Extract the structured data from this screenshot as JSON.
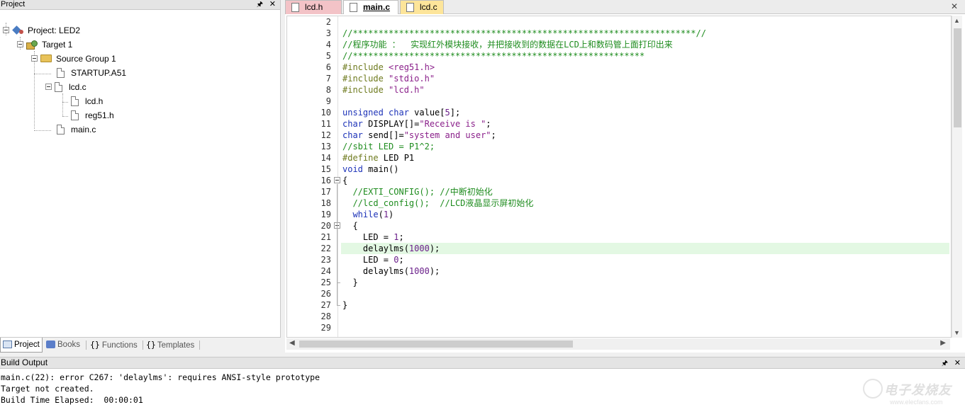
{
  "project_pane": {
    "title": "Project",
    "tree": {
      "project_label": "Project: LED2",
      "target_label": "Target 1",
      "group_label": "Source Group 1",
      "files": [
        {
          "label": "STARTUP.A51"
        },
        {
          "label": "lcd.c"
        },
        {
          "label": "lcd.h"
        },
        {
          "label": "reg51.h"
        },
        {
          "label": "main.c"
        }
      ]
    },
    "tabs": [
      {
        "label": "Project",
        "icon": "project-tab-icon"
      },
      {
        "label": "Books",
        "icon": "books-icon"
      },
      {
        "label": "Functions",
        "icon": "functions-icon"
      },
      {
        "label": "Templates",
        "icon": "templates-icon"
      }
    ]
  },
  "editor": {
    "tabs": [
      {
        "label": "lcd.h",
        "color": "#f3c3c7"
      },
      {
        "label": "main.c",
        "color": "#ffffff"
      },
      {
        "label": "lcd.c",
        "color": "#fde59a"
      }
    ],
    "highlight_line": "22",
    "lines": [
      {
        "n": "2",
        "parts": []
      },
      {
        "n": "3",
        "parts": [
          {
            "t": "//*******************************************************************//",
            "c": "c-com"
          }
        ]
      },
      {
        "n": "4",
        "parts": [
          {
            "t": "//程序功能 ：  实现红外模块接收，并把接收到的数据在LCD上和数码管上面打印出来",
            "c": "c-com"
          }
        ]
      },
      {
        "n": "5",
        "parts": [
          {
            "t": "//*********************************************************",
            "c": "c-com"
          }
        ]
      },
      {
        "n": "6",
        "parts": [
          {
            "t": "#include ",
            "c": "c-pp"
          },
          {
            "t": "<reg51.h>",
            "c": "c-str"
          }
        ]
      },
      {
        "n": "7",
        "parts": [
          {
            "t": "#include ",
            "c": "c-pp"
          },
          {
            "t": "\"stdio.h\"",
            "c": "c-str"
          }
        ]
      },
      {
        "n": "8",
        "parts": [
          {
            "t": "#include ",
            "c": "c-pp"
          },
          {
            "t": "\"lcd.h\"",
            "c": "c-str"
          }
        ]
      },
      {
        "n": "9",
        "parts": []
      },
      {
        "n": "10",
        "parts": [
          {
            "t": "unsigned ",
            "c": "c-kw"
          },
          {
            "t": "char ",
            "c": "c-kw"
          },
          {
            "t": "value[",
            "c": "c-def"
          },
          {
            "t": "5",
            "c": "c-num"
          },
          {
            "t": "];",
            "c": "c-def"
          }
        ]
      },
      {
        "n": "11",
        "parts": [
          {
            "t": "char ",
            "c": "c-kw"
          },
          {
            "t": "DISPLAY[]=",
            "c": "c-def"
          },
          {
            "t": "\"Receive is \"",
            "c": "c-str"
          },
          {
            "t": ";",
            "c": "c-def"
          }
        ]
      },
      {
        "n": "12",
        "parts": [
          {
            "t": "char ",
            "c": "c-kw"
          },
          {
            "t": "send[]=",
            "c": "c-def"
          },
          {
            "t": "\"system and user\"",
            "c": "c-str"
          },
          {
            "t": ";",
            "c": "c-def"
          }
        ]
      },
      {
        "n": "13",
        "parts": [
          {
            "t": "//sbit LED = P1^2;",
            "c": "c-com"
          }
        ]
      },
      {
        "n": "14",
        "parts": [
          {
            "t": "#define ",
            "c": "c-pp"
          },
          {
            "t": "LED P1",
            "c": "c-def"
          }
        ]
      },
      {
        "n": "15",
        "parts": [
          {
            "t": "void ",
            "c": "c-kw"
          },
          {
            "t": "main()",
            "c": "c-def"
          }
        ]
      },
      {
        "n": "16",
        "parts": [
          {
            "t": "{",
            "c": "c-def"
          }
        ]
      },
      {
        "n": "17",
        "parts": [
          {
            "t": "  //EXTI_CONFIG(); //中断初始化",
            "c": "c-com"
          }
        ]
      },
      {
        "n": "18",
        "parts": [
          {
            "t": "  //lcd_config();  //LCD液晶显示屏初始化",
            "c": "c-com"
          }
        ]
      },
      {
        "n": "19",
        "parts": [
          {
            "t": "  ",
            "c": "c-def"
          },
          {
            "t": "while",
            "c": "c-kw"
          },
          {
            "t": "(",
            "c": "c-def"
          },
          {
            "t": "1",
            "c": "c-num"
          },
          {
            "t": ")",
            "c": "c-def"
          }
        ]
      },
      {
        "n": "20",
        "parts": [
          {
            "t": "  {",
            "c": "c-def"
          }
        ]
      },
      {
        "n": "21",
        "parts": [
          {
            "t": "    LED = ",
            "c": "c-def"
          },
          {
            "t": "1",
            "c": "c-num"
          },
          {
            "t": ";",
            "c": "c-def"
          }
        ]
      },
      {
        "n": "22",
        "parts": [
          {
            "t": "    delaylms(",
            "c": "c-def"
          },
          {
            "t": "1000",
            "c": "c-num"
          },
          {
            "t": ");",
            "c": "c-def"
          }
        ]
      },
      {
        "n": "23",
        "parts": [
          {
            "t": "    LED = ",
            "c": "c-def"
          },
          {
            "t": "0",
            "c": "c-num"
          },
          {
            "t": ";",
            "c": "c-def"
          }
        ]
      },
      {
        "n": "24",
        "parts": [
          {
            "t": "    delaylms(",
            "c": "c-def"
          },
          {
            "t": "1000",
            "c": "c-num"
          },
          {
            "t": ");",
            "c": "c-def"
          }
        ]
      },
      {
        "n": "25",
        "parts": [
          {
            "t": "  }",
            "c": "c-def"
          }
        ]
      },
      {
        "n": "26",
        "parts": []
      },
      {
        "n": "27",
        "parts": [
          {
            "t": "}",
            "c": "c-def"
          }
        ]
      },
      {
        "n": "28",
        "parts": []
      },
      {
        "n": "29",
        "parts": []
      }
    ]
  },
  "build_output": {
    "title": "Build Output",
    "lines": [
      "main.c(22): error C267: 'delaylms': requires ANSI-style prototype",
      "Target not created.",
      "Build Time Elapsed:  00:00:01"
    ]
  },
  "watermark": {
    "text": "电子发烧友",
    "sub": "www.elecfans.com"
  }
}
